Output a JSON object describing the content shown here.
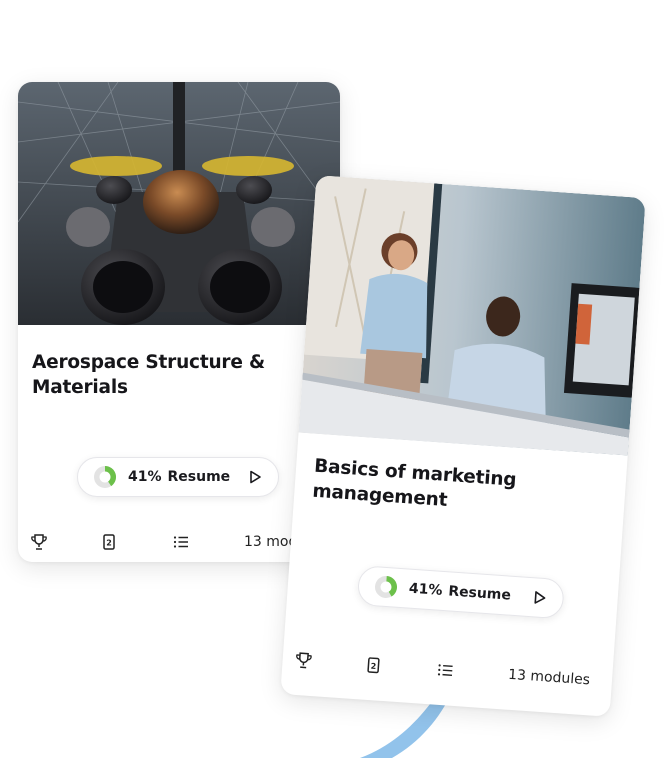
{
  "cards": [
    {
      "title": "Aerospace Structure & Materials",
      "progress_percent_label": "41%",
      "progress_fraction": 0.41,
      "resume_label": "Resume",
      "modules_label": "13 modules",
      "footer_icons": [
        "trophy-icon",
        "certificate-icon",
        "list-icon"
      ]
    },
    {
      "title": "Basics of marketing management",
      "progress_percent_label": "41%",
      "progress_fraction": 0.41,
      "resume_label": "Resume",
      "modules_label": "13 modules",
      "footer_icons": [
        "trophy-icon",
        "certificate-icon",
        "list-icon"
      ]
    }
  ],
  "colors": {
    "progress_fill": "#6cc04a",
    "progress_track": "#e3e3e3",
    "accent_arc": "#7fb8e8",
    "text": "#16161a"
  }
}
